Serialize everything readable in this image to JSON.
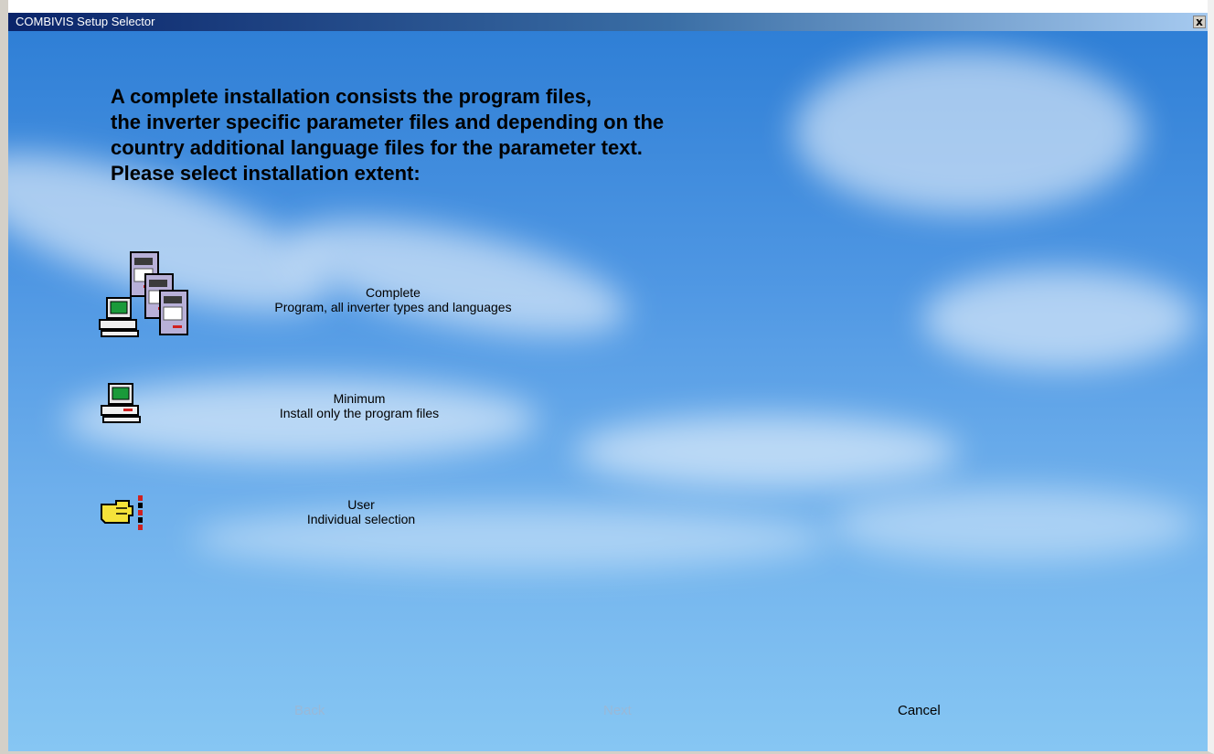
{
  "window": {
    "title": "COMBIVIS Setup Selector",
    "close_glyph": "x"
  },
  "heading": {
    "lines": [
      "A complete installation consists the program files,",
      "the inverter specific parameter files and depending on the",
      "country additional language files for the parameter text.",
      "Please select installation extent:"
    ]
  },
  "options": [
    {
      "icon": "computer-with-inverters-icon",
      "title": "Complete",
      "subtitle": "Program, all inverter types and languages"
    },
    {
      "icon": "computer-icon",
      "title": "Minimum",
      "subtitle": "Install only the program files"
    },
    {
      "icon": "pointing-hand-icon",
      "title": "User",
      "subtitle": "Individual selection"
    }
  ],
  "nav": {
    "back": "Back",
    "next": "Next",
    "cancel": "Cancel"
  },
  "colors": {
    "sky_top": "#2f7fd6",
    "sky_bottom": "#86c6f3",
    "disabled_text": "#9ab8d6"
  }
}
